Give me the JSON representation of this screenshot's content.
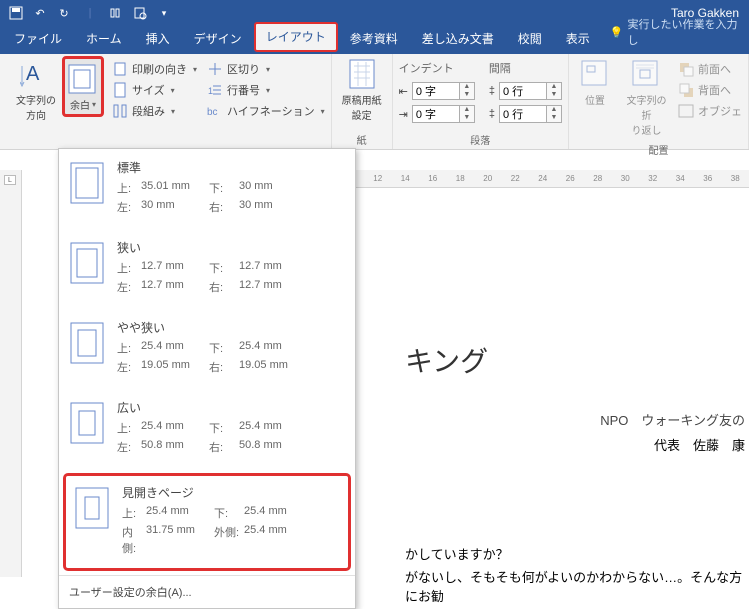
{
  "titlebar": {
    "user": "Taro Gakken"
  },
  "tabs": {
    "file": "ファイル",
    "home": "ホーム",
    "insert": "挿入",
    "design": "デザイン",
    "layout": "レイアウト",
    "references": "参考資料",
    "mailings": "差し込み文書",
    "review": "校閲",
    "view": "表示",
    "tell": "実行したい作業を入力し"
  },
  "ribbon": {
    "textdir": "文字列の\n方向",
    "margins": "余白",
    "orient": "印刷の向き",
    "size": "サイズ",
    "columns": "段組み",
    "breaks": "区切り",
    "linenum": "行番号",
    "hyphen": "ハイフネーション",
    "manuscript": "原稿用紙\n設定",
    "manuscript_grp": "紙",
    "indent_hdr": "インデント",
    "spacing_hdr": "間隔",
    "indent_left": "0 字",
    "indent_right": "0 字",
    "spacing_before": "0 行",
    "spacing_after": "0 行",
    "para_grp": "段落",
    "position": "位置",
    "wrap": "文字列の折\nり返し",
    "front": "前面へ",
    "back": "背面へ",
    "objects": "オブジェ",
    "arrange_grp": "配置"
  },
  "ruler": [
    "12",
    "14",
    "16",
    "18",
    "20",
    "22",
    "24",
    "26",
    "28",
    "30",
    "32",
    "34",
    "36",
    "38"
  ],
  "margins_menu": {
    "items": [
      {
        "title": "標準",
        "t": "35.01 mm",
        "b": "30 mm",
        "l": "30 mm",
        "r": "30 mm"
      },
      {
        "title": "狭い",
        "t": "12.7 mm",
        "b": "12.7 mm",
        "l": "12.7 mm",
        "r": "12.7 mm"
      },
      {
        "title": "やや狭い",
        "t": "25.4 mm",
        "b": "25.4 mm",
        "l": "19.05 mm",
        "r": "19.05 mm"
      },
      {
        "title": "広い",
        "t": "25.4 mm",
        "b": "25.4 mm",
        "l": "50.8 mm",
        "r": "50.8 mm"
      },
      {
        "title": "見開きページ",
        "t": "25.4 mm",
        "b": "25.4 mm",
        "l": "31.75 mm",
        "r": "25.4 mm",
        "l_lbl": "内側:",
        "r_lbl": "外側:"
      }
    ],
    "labels": {
      "t": "上:",
      "b": "下:",
      "l": "左:",
      "r": "右:"
    },
    "custom": "ユーザー設定の余白(A)..."
  },
  "doc": {
    "title_fragment": "キング",
    "org": "NPO　ウォーキング友の",
    "rep": "代表　佐藤　康",
    "body1": "かしていますか？",
    "body2": "がないし、そもそも何がよいのかわからない…。そんな方にお勧"
  }
}
